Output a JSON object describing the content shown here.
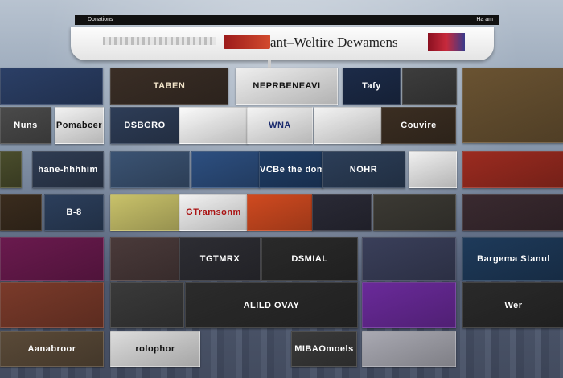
{
  "titlebar": {
    "left": "Donations",
    "right": "Ha am"
  },
  "banner": {
    "title": "ant–Weltire Dewamens"
  },
  "tiles": [
    {
      "label": "",
      "bg": "#2b3f66",
      "fg": "#fff"
    },
    {
      "label": "TABEN",
      "bg": "#3a2e26",
      "fg": "#f1e3c8"
    },
    {
      "label": "NEPRBENEAVI",
      "bg": "#eeeeee",
      "fg": "#111"
    },
    {
      "label": "Tafy",
      "bg": "#1c2b48",
      "fg": "#fff"
    },
    {
      "label": "",
      "bg": "#3d3d3d",
      "fg": "#fff"
    },
    {
      "label": "",
      "bg": "#6a5332",
      "fg": "#fff"
    },
    {
      "label": "Nuns",
      "bg": "#4a4a4a",
      "fg": "#fff"
    },
    {
      "label": "Pomabcer",
      "bg": "#f2f2f2",
      "fg": "#111"
    },
    {
      "label": "DSBGRO",
      "bg": "#2e3d57",
      "fg": "#fff"
    },
    {
      "label": "",
      "bg": "#fafafa",
      "fg": "#111"
    },
    {
      "label": "WNA",
      "bg": "#f4f4f4",
      "fg": "#1b2b6e"
    },
    {
      "label": "",
      "bg": "#f3f3f3",
      "fg": "#b22"
    },
    {
      "label": "Couvire",
      "bg": "#3b2e22",
      "fg": "#fff"
    },
    {
      "label": "",
      "bg": "#4a4d2c",
      "fg": "#fff"
    },
    {
      "label": "hane-hhhhim",
      "bg": "#2f3c52",
      "fg": "#fff"
    },
    {
      "label": "",
      "bg": "#3b5373",
      "fg": "#fff"
    },
    {
      "label": "",
      "bg": "#2d4f80",
      "fg": "#fff"
    },
    {
      "label": "VCBe the domax",
      "bg": "#1f3d66",
      "fg": "#fff"
    },
    {
      "label": "NOHR",
      "bg": "#2c3e58",
      "fg": "#fff"
    },
    {
      "label": "",
      "bg": "#f0f0f0",
      "fg": "#111"
    },
    {
      "label": "",
      "bg": "#9b2b20",
      "fg": "#fff"
    },
    {
      "label": "",
      "bg": "#3a2c1e",
      "fg": "#fff"
    },
    {
      "label": "B-8",
      "bg": "#2c3f5c",
      "fg": "#fff"
    },
    {
      "label": "",
      "bg": "#c9c26a",
      "fg": "#111"
    },
    {
      "label": "GTramsonm",
      "bg": "#f2f2f2",
      "fg": "#a11"
    },
    {
      "label": "",
      "bg": "#d04a20",
      "fg": "#fff"
    },
    {
      "label": "",
      "bg": "#2a2a36",
      "fg": "#fff"
    },
    {
      "label": "",
      "bg": "#3c3a34",
      "fg": "#fff"
    },
    {
      "label": "",
      "bg": "#3a2a30",
      "fg": "#fff"
    },
    {
      "label": "",
      "bg": "#6a1a4e",
      "fg": "#fff"
    },
    {
      "label": "",
      "bg": "#4a3a3a",
      "fg": "#fff"
    },
    {
      "label": "TGTMRX",
      "bg": "#2d2d33",
      "fg": "#fff"
    },
    {
      "label": "DSMIAL",
      "bg": "#2a2a2a",
      "fg": "#fff"
    },
    {
      "label": "",
      "bg": "#3a3f5a",
      "fg": "#fff"
    },
    {
      "label": "Bargema Stanul",
      "bg": "#1e3a5a",
      "fg": "#fff"
    },
    {
      "label": "",
      "bg": "#7a3a2a",
      "fg": "#fff"
    },
    {
      "label": "",
      "bg": "#3a3a3a",
      "fg": "#fff"
    },
    {
      "label": "ALILD OVAY",
      "bg": "#2b2b2b",
      "fg": "#fff"
    },
    {
      "label": "",
      "bg": "#6a2a9a",
      "fg": "#fff"
    },
    {
      "label": "Wer",
      "bg": "#2a2a2a",
      "fg": "#fff"
    },
    {
      "label": "Aanabroor",
      "bg": "#5a4a38",
      "fg": "#fff"
    },
    {
      "label": "rolophor",
      "bg": "#dcdcdc",
      "fg": "#111"
    },
    {
      "label": "MIBAOmoels",
      "bg": "#3a3a3a",
      "fg": "#fff"
    },
    {
      "label": "",
      "bg": "#a9a9b2",
      "fg": "#111"
    }
  ]
}
